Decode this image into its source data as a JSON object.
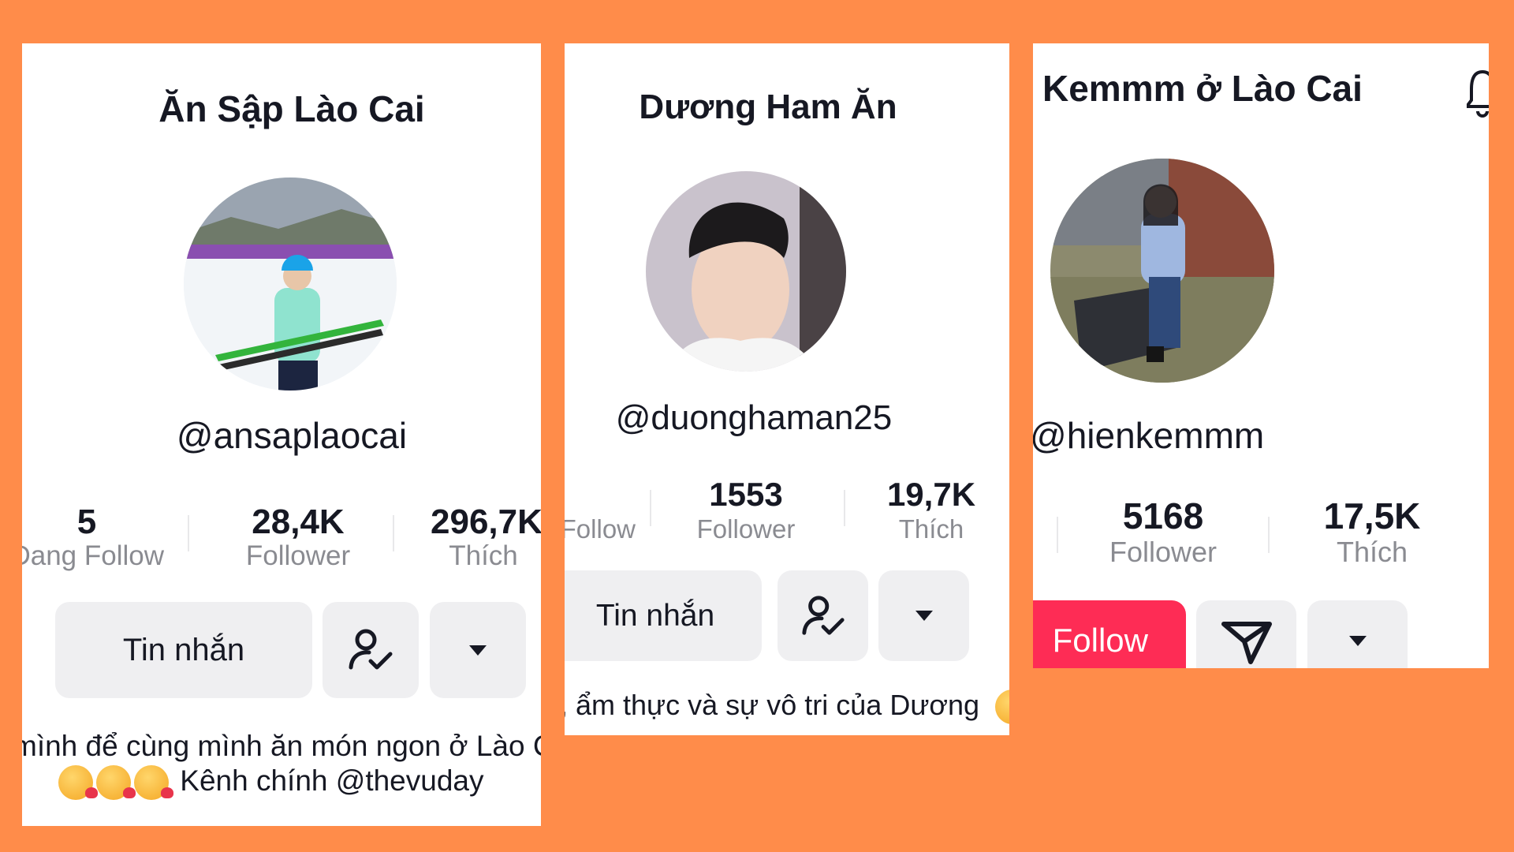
{
  "profiles": [
    {
      "name": "Ăn Sập Lào Cai",
      "handle": "@ansaplaocai",
      "stats": [
        {
          "value": "5",
          "label": "Đang Follow"
        },
        {
          "value": "28,4K",
          "label": "Follower"
        },
        {
          "value": "296,7K",
          "label": "Thích"
        }
      ],
      "primary_button": "Tin nhắn",
      "bio_line1": "mình để cùng mình ăn món ngon ở Lào Cai",
      "bio_line2": "Kênh chính @thevuday"
    },
    {
      "name": "Dương Ham Ăn",
      "handle": "@duonghaman25",
      "stats": [
        {
          "value": "",
          "label": "Follow"
        },
        {
          "value": "1553",
          "label": "Follower"
        },
        {
          "value": "19,7K",
          "label": "Thích"
        }
      ],
      "primary_button": "Tin nhắn",
      "bio_line1": ", ẩm thực và sự vô tri của Dương"
    },
    {
      "name": "Kemmm ở Lào Cai",
      "handle": "@hienkemmm",
      "stats": [
        {
          "value": "5168",
          "label": "Follower"
        },
        {
          "value": "17,5K",
          "label": "Thích"
        }
      ],
      "primary_button": "Follow"
    }
  ],
  "icons": [
    "add-friend-check-icon",
    "dropdown-arrow-icon",
    "send-message-icon",
    "bell-icon"
  ],
  "colors": {
    "background": "#FF8C4A",
    "follow_button": "#FE2C55",
    "button_gray": "#EFEFF1"
  }
}
